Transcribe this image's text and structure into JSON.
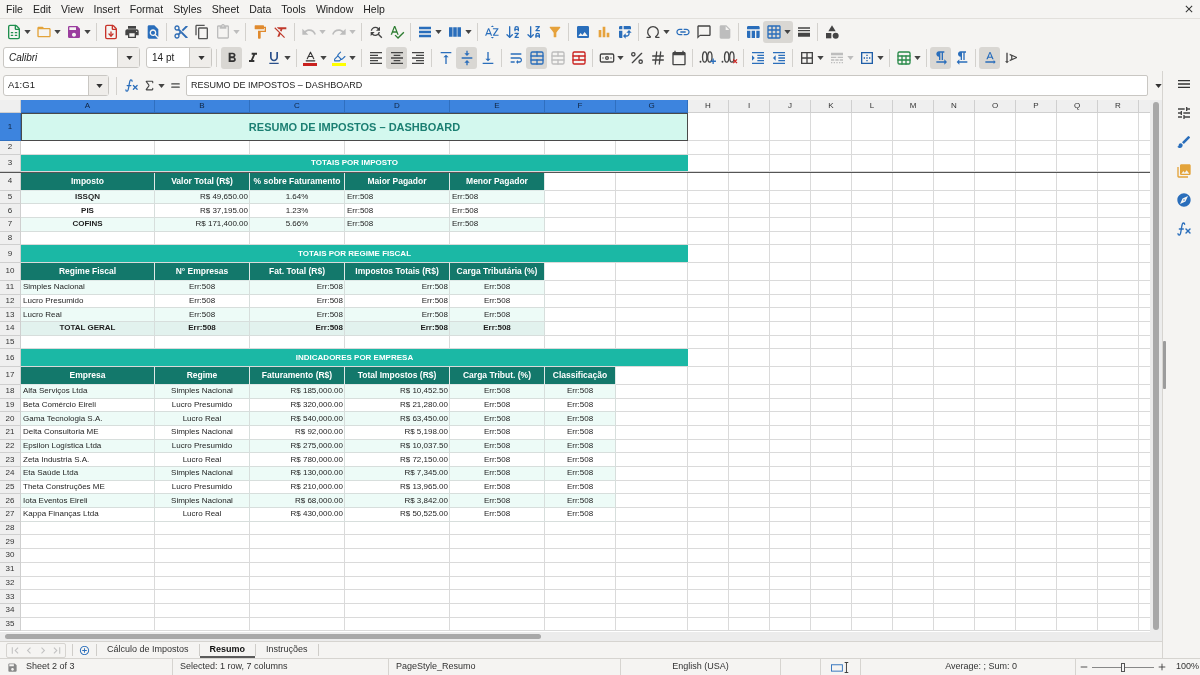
{
  "menu_bar": [
    "File",
    "Edit",
    "View",
    "Insert",
    "Format",
    "Styles",
    "Sheet",
    "Data",
    "Tools",
    "Window",
    "Help"
  ],
  "standard_toolbar": [
    {
      "pressed": false,
      "disabled": false
    },
    {
      "pressed": false,
      "disabled": false
    },
    {
      "pressed": false,
      "disabled": false
    },
    {
      "pressed": false,
      "disabled": false
    },
    {
      "pressed": false,
      "disabled": false
    },
    {
      "pressed": false,
      "disabled": false
    },
    {
      "pressed": false,
      "disabled": false
    },
    {
      "pressed": false,
      "disabled": false
    },
    {
      "pressed": false,
      "disabled": true
    },
    {
      "pressed": false,
      "disabled": false
    },
    {
      "pressed": false,
      "disabled": false
    },
    {
      "pressed": false,
      "disabled": true
    },
    {
      "pressed": false,
      "disabled": true
    },
    {
      "pressed": false,
      "disabled": false
    },
    {
      "pressed": false,
      "disabled": false
    },
    {
      "pressed": false,
      "disabled": false
    },
    {
      "pressed": false,
      "disabled": false
    },
    {
      "pressed": false,
      "disabled": false
    },
    {
      "pressed": false,
      "disabled": false
    },
    {
      "pressed": false,
      "disabled": false
    },
    {
      "pressed": false,
      "disabled": false
    },
    {
      "pressed": false,
      "disabled": false
    },
    {
      "pressed": false,
      "disabled": false
    },
    {
      "pressed": false,
      "disabled": false
    },
    {
      "pressed": false,
      "disabled": false
    },
    {
      "pressed": false,
      "disabled": false
    },
    {
      "pressed": false,
      "disabled": false
    },
    {
      "pressed": false,
      "disabled": true
    },
    {
      "pressed": false,
      "disabled": false
    },
    {
      "pressed": true,
      "disabled": false
    },
    {
      "pressed": false,
      "disabled": false
    },
    {
      "pressed": false,
      "disabled": false
    }
  ],
  "formatting_toolbar": {
    "font_name": "Calibri",
    "font_size": "14 pt",
    "buttons": [
      {
        "pressed": true,
        "disabled": false
      },
      {
        "pressed": false,
        "disabled": false
      },
      {
        "pressed": false,
        "disabled": false
      },
      {
        "pressed": false,
        "disabled": false
      },
      {
        "pressed": false,
        "disabled": false
      },
      {
        "pressed": false,
        "disabled": false
      },
      {
        "pressed": true,
        "disabled": false
      },
      {
        "pressed": false,
        "disabled": false
      },
      {
        "pressed": false,
        "disabled": false
      },
      {
        "pressed": true,
        "disabled": false
      },
      {
        "pressed": false,
        "disabled": false
      },
      {
        "pressed": false,
        "disabled": false
      },
      {
        "pressed": true,
        "disabled": false
      },
      {
        "pressed": false,
        "disabled": true
      },
      {
        "pressed": false,
        "disabled": false
      },
      {
        "pressed": false,
        "disabled": false
      },
      {
        "pressed": false,
        "disabled": false
      },
      {
        "pressed": false,
        "disabled": false
      },
      {
        "pressed": false,
        "disabled": false
      },
      {
        "pressed": false,
        "disabled": false
      },
      {
        "pressed": false,
        "disabled": false
      },
      {
        "pressed": false,
        "disabled": false
      },
      {
        "pressed": false,
        "disabled": false
      },
      {
        "pressed": false,
        "disabled": false
      },
      {
        "pressed": false,
        "disabled": true
      },
      {
        "pressed": false,
        "disabled": false
      },
      {
        "pressed": false,
        "disabled": false
      },
      {
        "pressed": true,
        "disabled": false
      },
      {
        "pressed": false,
        "disabled": false
      },
      {
        "pressed": true,
        "disabled": false
      },
      {
        "pressed": false,
        "disabled": false
      }
    ]
  },
  "formula_bar": {
    "name_box": "A1:G1",
    "content": "RESUMO DE IMPOSTOS – DASHBOARD"
  },
  "sheet": {
    "column_headers": [
      {
        "label": "A",
        "selected": true
      },
      {
        "label": "B",
        "selected": true
      },
      {
        "label": "C",
        "selected": true
      },
      {
        "label": "D",
        "selected": true
      },
      {
        "label": "E",
        "selected": true
      },
      {
        "label": "F",
        "selected": true
      },
      {
        "label": "G",
        "selected": true
      },
      {
        "label": "H",
        "selected": false
      },
      {
        "label": "I",
        "selected": false
      },
      {
        "label": "J",
        "selected": false
      },
      {
        "label": "K",
        "selected": false
      },
      {
        "label": "L",
        "selected": false
      },
      {
        "label": "M",
        "selected": false
      },
      {
        "label": "N",
        "selected": false
      },
      {
        "label": "O",
        "selected": false
      },
      {
        "label": "P",
        "selected": false
      },
      {
        "label": "Q",
        "selected": false
      },
      {
        "label": "R",
        "selected": false
      }
    ],
    "row_headers": [
      {
        "label": "1",
        "selected": true
      },
      {
        "label": "2",
        "selected": false
      },
      {
        "label": "3",
        "selected": false
      },
      {
        "label": "4",
        "selected": false
      },
      {
        "label": "5",
        "selected": false
      },
      {
        "label": "6",
        "selected": false
      },
      {
        "label": "7",
        "selected": false
      },
      {
        "label": "8",
        "selected": false
      },
      {
        "label": "9",
        "selected": false
      },
      {
        "label": "10",
        "selected": false
      },
      {
        "label": "11",
        "selected": false
      },
      {
        "label": "12",
        "selected": false
      },
      {
        "label": "13",
        "selected": false
      },
      {
        "label": "14",
        "selected": false
      },
      {
        "label": "15",
        "selected": false
      },
      {
        "label": "16",
        "selected": false
      },
      {
        "label": "17",
        "selected": false
      },
      {
        "label": "18",
        "selected": false
      },
      {
        "label": "19",
        "selected": false
      },
      {
        "label": "20",
        "selected": false
      },
      {
        "label": "21",
        "selected": false
      },
      {
        "label": "22",
        "selected": false
      },
      {
        "label": "23",
        "selected": false
      },
      {
        "label": "24",
        "selected": false
      },
      {
        "label": "25",
        "selected": false
      },
      {
        "label": "26",
        "selected": false
      },
      {
        "label": "27",
        "selected": false
      },
      {
        "label": "28",
        "selected": false
      },
      {
        "label": "29",
        "selected": false
      },
      {
        "label": "30",
        "selected": false
      },
      {
        "label": "31",
        "selected": false
      },
      {
        "label": "32",
        "selected": false
      },
      {
        "label": "33",
        "selected": false
      },
      {
        "label": "34",
        "selected": false
      },
      {
        "label": "35",
        "selected": false
      }
    ],
    "title": "RESUMO DE IMPOSTOS – DASHBOARD",
    "sections": [
      {
        "title": "TOTAIS POR IMPOSTO",
        "columns": [
          "Imposto",
          "Valor Total (R$)",
          "% sobre Faturamento",
          "Maior Pagador",
          "Menor Pagador"
        ],
        "rows": [
          {
            "kind": "data",
            "cells": [
              "ISSQN",
              "R$ 49,650.00",
              "1.64%",
              "Err:508",
              "Err:508"
            ]
          },
          {
            "kind": "data",
            "cells": [
              "PIS",
              "R$ 37,195.00",
              "1.23%",
              "Err:508",
              "Err:508"
            ]
          },
          {
            "kind": "data",
            "cells": [
              "COFINS",
              "R$ 171,400.00",
              "5.66%",
              "Err:508",
              "Err:508"
            ]
          }
        ]
      },
      {
        "title": "TOTAIS POR REGIME FISCAL",
        "columns": [
          "Regime Fiscal",
          "N° Empresas",
          "Fat. Total (R$)",
          "Impostos Totais (R$)",
          "Carga Tributária (%)"
        ],
        "rows": [
          {
            "kind": "data",
            "cells": [
              "Simples Nacional",
              "Err:508",
              "Err:508",
              "Err:508",
              "Err:508"
            ]
          },
          {
            "kind": "data",
            "cells": [
              "Lucro Presumido",
              "Err:508",
              "Err:508",
              "Err:508",
              "Err:508"
            ]
          },
          {
            "kind": "data",
            "cells": [
              "Lucro Real",
              "Err:508",
              "Err:508",
              "Err:508",
              "Err:508"
            ]
          },
          {
            "kind": "total",
            "cells": [
              "TOTAL GERAL",
              "Err:508",
              "Err:508",
              "Err:508",
              "Err:508"
            ]
          }
        ]
      },
      {
        "title": "INDICADORES POR EMPRESA",
        "columns": [
          "Empresa",
          "Regime",
          "Faturamento (R$)",
          "Total Impostos (R$)",
          "Carga Tribut. (%)",
          "Classificação"
        ],
        "rows": [
          {
            "kind": "data",
            "cells": [
              "Alfa Serviços Ltda",
              "Simples Nacional",
              "R$ 185,000.00",
              "R$ 10,452.50",
              "Err:508",
              "Err:508"
            ]
          },
          {
            "kind": "data",
            "cells": [
              "Beta Comércio Eireli",
              "Lucro Presumido",
              "R$ 320,000.00",
              "R$ 21,280.00",
              "Err:508",
              "Err:508"
            ]
          },
          {
            "kind": "data",
            "cells": [
              "Gama Tecnologia S.A.",
              "Lucro Real",
              "R$ 540,000.00",
              "R$ 63,450.00",
              "Err:508",
              "Err:508"
            ]
          },
          {
            "kind": "data",
            "cells": [
              "Delta Consultoria ME",
              "Simples Nacional",
              "R$ 92,000.00",
              "R$ 5,198.00",
              "Err:508",
              "Err:508"
            ]
          },
          {
            "kind": "data",
            "cells": [
              "Epsilon Logística Ltda",
              "Lucro Presumido",
              "R$ 275,000.00",
              "R$ 10,037.50",
              "Err:508",
              "Err:508"
            ]
          },
          {
            "kind": "data",
            "cells": [
              "Zeta Industria S.A.",
              "Lucro Real",
              "R$ 780,000.00",
              "R$ 72,150.00",
              "Err:508",
              "Err:508"
            ]
          },
          {
            "kind": "data",
            "cells": [
              "Eta Saúde Ltda",
              "Simples Nacional",
              "R$ 130,000.00",
              "R$ 7,345.00",
              "Err:508",
              "Err:508"
            ]
          },
          {
            "kind": "data",
            "cells": [
              "Theta Construções ME",
              "Lucro Presumido",
              "R$ 210,000.00",
              "R$ 13,965.00",
              "Err:508",
              "Err:508"
            ]
          },
          {
            "kind": "data",
            "cells": [
              "Iota Eventos Eireli",
              "Simples Nacional",
              "R$ 68,000.00",
              "R$ 3,842.00",
              "Err:508",
              "Err:508"
            ]
          },
          {
            "kind": "data",
            "cells": [
              "Kappa Finanças Ltda",
              "Lucro Real",
              "R$ 430,000.00",
              "R$ 50,525.00",
              "Err:508",
              "Err:508"
            ]
          }
        ]
      }
    ]
  },
  "sheet_tabs": [
    {
      "label": "Cálculo de Impostos",
      "selected": false
    },
    {
      "label": "Resumo",
      "selected": true
    },
    {
      "label": "Instruções",
      "selected": false
    }
  ],
  "status_bar": {
    "sheet": "Sheet 2 of 3",
    "selection": "Selected: 1 row, 7 columns",
    "page_style": "PageStyle_Resumo",
    "language": "English (USA)",
    "summary": "Average: ; Sum: 0",
    "zoom": {
      "level": 0.5,
      "reading": "100%"
    }
  }
}
